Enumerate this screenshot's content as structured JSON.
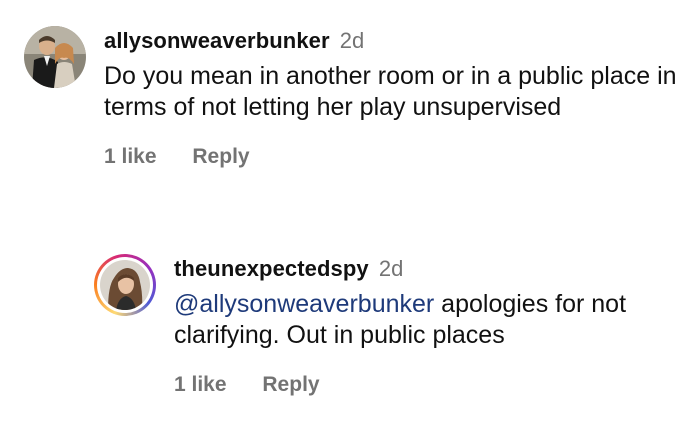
{
  "comments": [
    {
      "username": "allysonweaverbunker",
      "time": "2d",
      "text": "Do you mean in another room or in a public place in terms of not letting her play unsupervised",
      "likes": "1 like",
      "reply_label": "Reply"
    },
    {
      "username": "theunexpectedspy",
      "time": "2d",
      "mention": "@allysonweaverbunker",
      "text": " apologies for not clarifying. Out in public places",
      "likes": "1 like",
      "reply_label": "Reply"
    }
  ],
  "colors": {
    "mention": "#1e3a7a",
    "meta": "#737373",
    "text": "#111111"
  },
  "icons": [
    "user-avatar-couple",
    "user-avatar-story-ring"
  ]
}
